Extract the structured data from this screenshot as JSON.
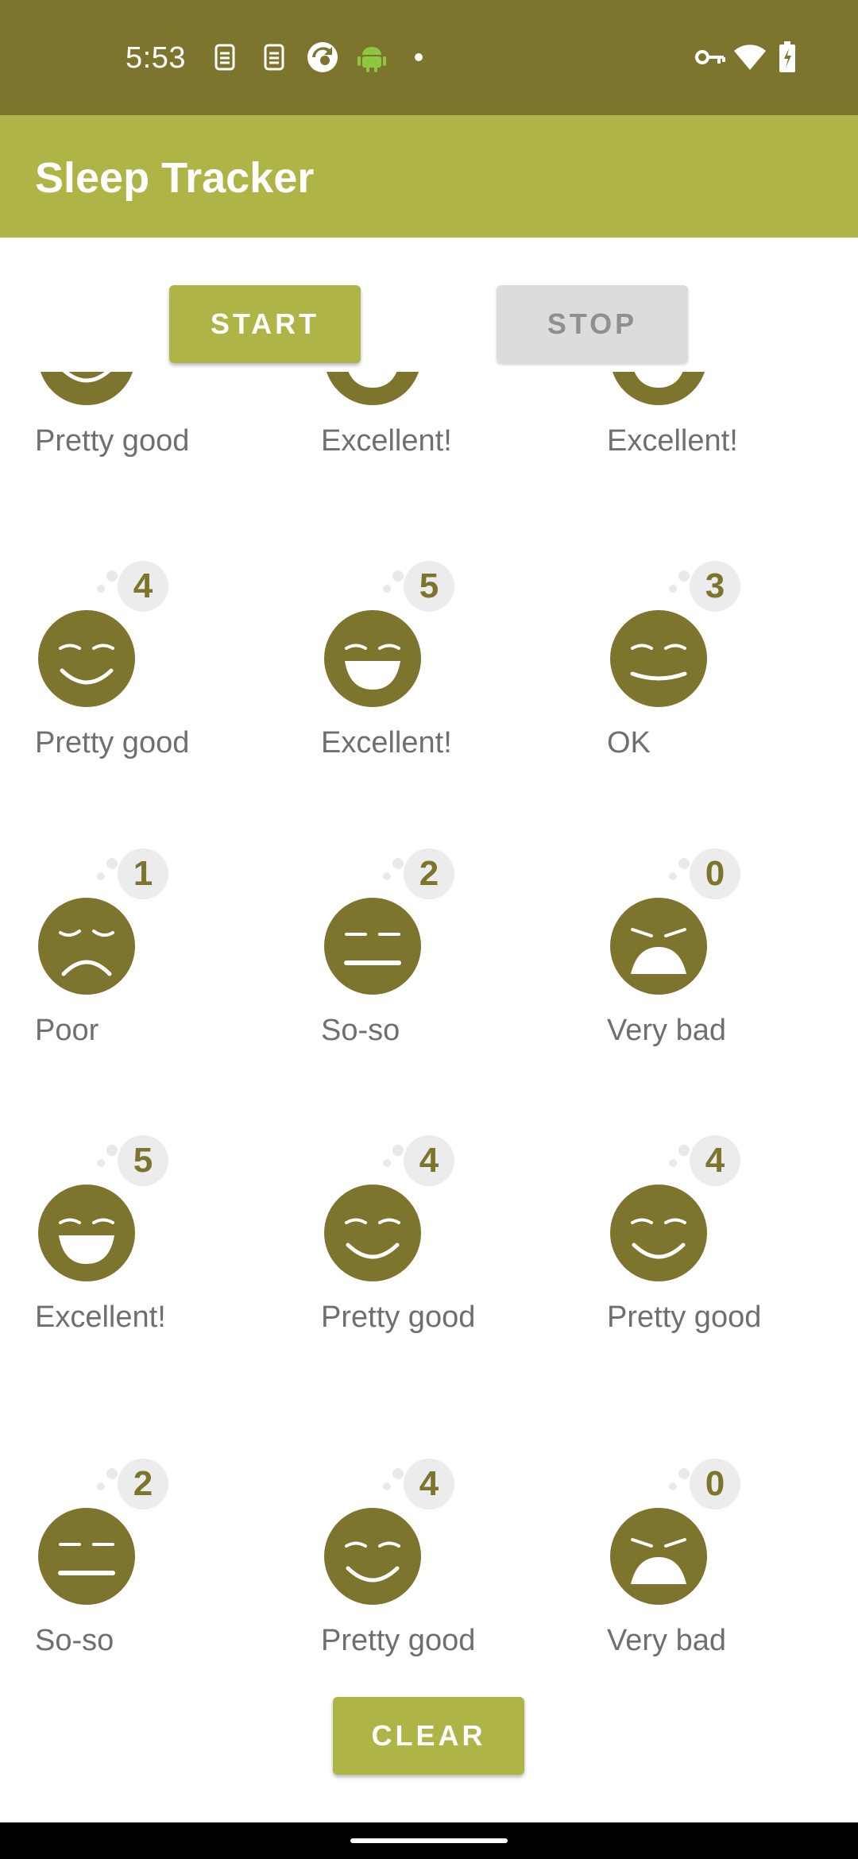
{
  "status_bar": {
    "time": "5:53",
    "left_icons": [
      "sim-card-icon",
      "sim-card-icon",
      "sync-app-icon",
      "android-icon",
      "notification-dot-icon"
    ],
    "right_icons": [
      "vpn-key-icon",
      "wifi-icon",
      "battery-charging-icon"
    ]
  },
  "app_bar": {
    "title": "Sleep Tracker"
  },
  "buttons": {
    "start": "START",
    "stop": "STOP",
    "clear": "CLEAR"
  },
  "colors": {
    "status_bar": "#7d752e",
    "app_bar": "#afb446",
    "face": "#7d752e",
    "button_active": "#afb446",
    "button_disabled": "#dcdcdc"
  },
  "rows": [
    {
      "items": [
        {
          "rating": "",
          "label": "Pretty good",
          "face": "pretty-good"
        },
        {
          "rating": "",
          "label": "Excellent!",
          "face": "excellent"
        },
        {
          "rating": "",
          "label": "Excellent!",
          "face": "excellent"
        }
      ]
    },
    {
      "items": [
        {
          "rating": "4",
          "label": "Pretty good",
          "face": "pretty-good"
        },
        {
          "rating": "5",
          "label": "Excellent!",
          "face": "excellent"
        },
        {
          "rating": "3",
          "label": "OK",
          "face": "ok"
        }
      ]
    },
    {
      "items": [
        {
          "rating": "1",
          "label": "Poor",
          "face": "poor"
        },
        {
          "rating": "2",
          "label": "So-so",
          "face": "so-so"
        },
        {
          "rating": "0",
          "label": "Very bad",
          "face": "very-bad"
        }
      ]
    },
    {
      "items": [
        {
          "rating": "5",
          "label": "Excellent!",
          "face": "excellent"
        },
        {
          "rating": "4",
          "label": "Pretty good",
          "face": "pretty-good"
        },
        {
          "rating": "4",
          "label": "Pretty good",
          "face": "pretty-good"
        }
      ]
    },
    {
      "items": [
        {
          "rating": "2",
          "label": "So-so",
          "face": "so-so"
        },
        {
          "rating": "4",
          "label": "Pretty good",
          "face": "pretty-good"
        },
        {
          "rating": "0",
          "label": "Very bad",
          "face": "very-bad"
        }
      ]
    }
  ]
}
